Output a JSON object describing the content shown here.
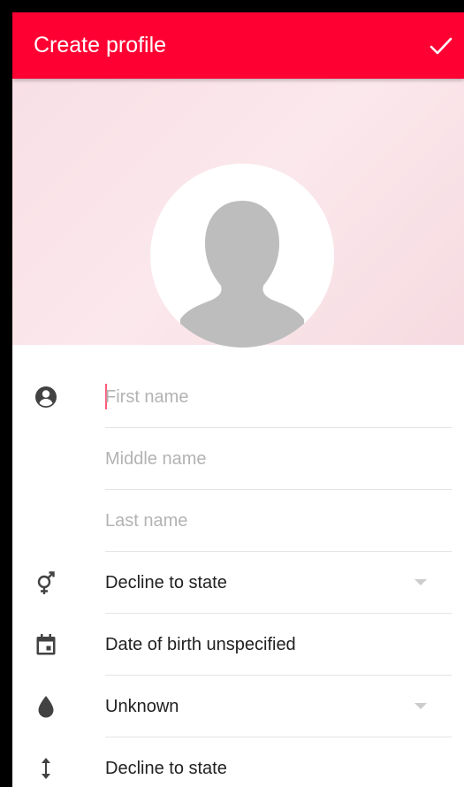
{
  "app_bar": {
    "title": "Create profile",
    "confirm_icon": "check-icon",
    "background_color": "#ff0033"
  },
  "header": {
    "avatar_icon": "person-silhouette-icon"
  },
  "form": {
    "first_name": {
      "icon": "account-circle-icon",
      "placeholder": "First name",
      "value": ""
    },
    "middle_name": {
      "placeholder": "Middle name",
      "value": ""
    },
    "last_name": {
      "placeholder": "Last name",
      "value": ""
    },
    "gender": {
      "icon": "gender-icon",
      "value": "Decline to state"
    },
    "date_of_birth": {
      "icon": "calendar-icon",
      "value": "Date of birth unspecified"
    },
    "blood_type": {
      "icon": "water-drop-icon",
      "value": "Unknown"
    },
    "height": {
      "icon": "vertical-arrows-icon",
      "value": "Decline to state"
    }
  }
}
